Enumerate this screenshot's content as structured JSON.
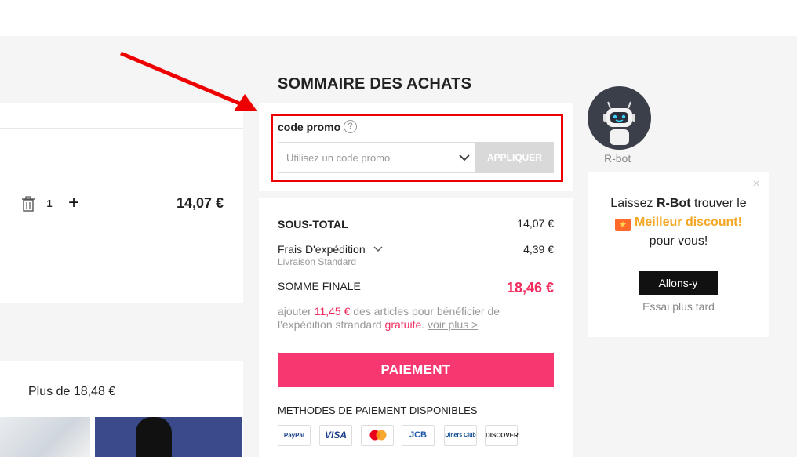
{
  "cart": {
    "quantity": "1",
    "item_price": "14,07 €",
    "recommend_label": "Plus de 18,48 €"
  },
  "summary": {
    "title": "SOMMAIRE DES ACHATS",
    "promo": {
      "label": "code promo",
      "help_glyph": "?",
      "placeholder": "Utilisez un code promo",
      "value": "",
      "apply_label": "APPLIQUER"
    },
    "subtotal": {
      "label": "SOUS-TOTAL",
      "value": "14,07 €"
    },
    "shipping": {
      "label": "Frais D'expédition",
      "sub": "Livraison Standard",
      "value": "4,39 €"
    },
    "final": {
      "label": "SOMME FINALE",
      "value": "18,46 €"
    },
    "note": {
      "before": "ajouter ",
      "amount": "11,45 €",
      "middle": " des articles pour bénéficier de l'expédition strandard ",
      "free": "gratuite",
      "after": ". ",
      "more": "voir plus >"
    },
    "pay_label": "PAIEMENT",
    "methods_title": "METHODES DE PAIEMENT DISPONIBLES",
    "payment_methods": [
      "PayPal",
      "VISA",
      "mastercard",
      "JCB",
      "Diners Club",
      "DISCOVER"
    ]
  },
  "bot": {
    "name": "R-bot",
    "close_glyph": "×",
    "line1_pre": "Laissez ",
    "line1_bold": "R-Bot",
    "line1_post": " trouver le",
    "line2": "Meilleur discount!",
    "line3": "pour vous!",
    "go_label": "Allons-y",
    "later_label": "Essai plus tard"
  },
  "colors": {
    "accent_pink": "#f73870",
    "price_pink": "#f02d5e",
    "highlight_red": "#ee0000",
    "discount_orange": "#f5a623"
  }
}
